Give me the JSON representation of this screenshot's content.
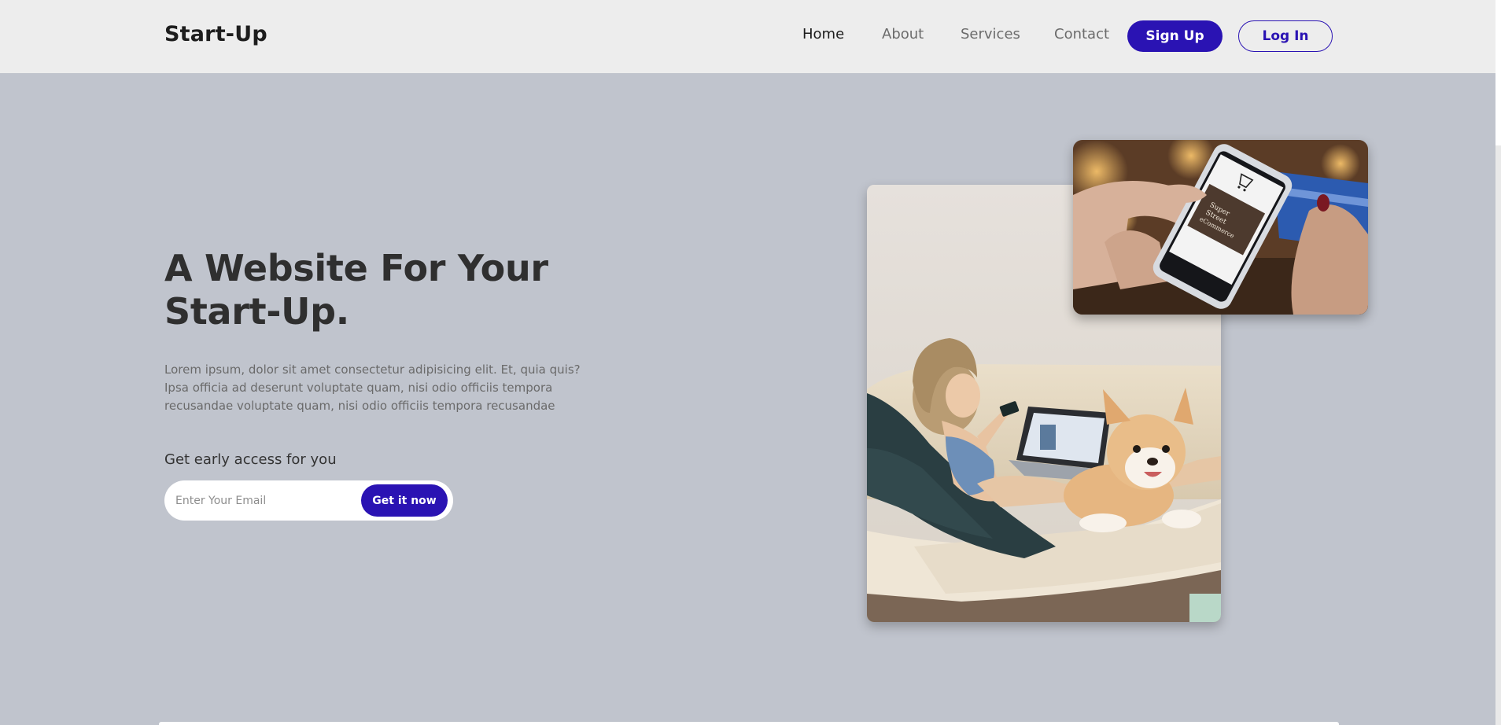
{
  "header": {
    "logo": "Start-Up",
    "nav": [
      {
        "label": "Home",
        "active": true
      },
      {
        "label": "About",
        "active": false
      },
      {
        "label": "Services",
        "active": false
      },
      {
        "label": "Contact",
        "active": false
      }
    ],
    "signup_label": "Sign Up",
    "login_label": "Log In"
  },
  "hero": {
    "title_line1": "A Website For Your",
    "title_line2": "Start-Up.",
    "description": "Lorem ipsum, dolor sit amet consectetur adipisicing elit. Et, quia quis? Ipsa officia ad deserunt voluptate quam, nisi odio officiis tempora recusandae voluptate quam, nisi odio officiis tempora recusandae",
    "access_label": "Get early access for you",
    "email_placeholder": "Enter Your Email",
    "email_value": "",
    "cta_label": "Get it now"
  },
  "colors": {
    "accent": "#2a13b3",
    "header_bg": "#ededed",
    "page_bg": "#c0c4cd"
  }
}
